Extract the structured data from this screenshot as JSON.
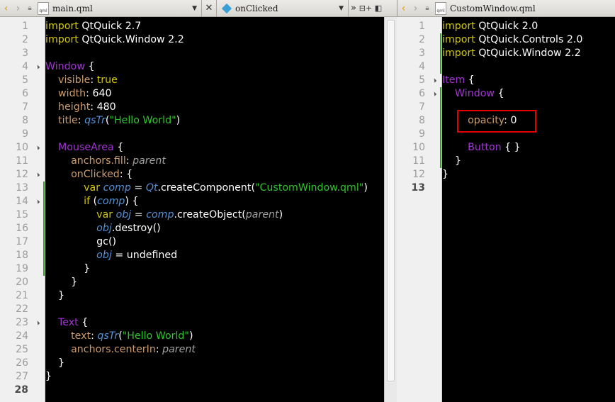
{
  "left_pane": {
    "file_name": "main.qml",
    "file_icon_label": "qml",
    "symbol": "onClicked",
    "extra_buttons": [
      "»",
      "⊟+",
      "◧"
    ],
    "lines": [
      {
        "n": "1",
        "seg": [
          {
            "c": "kw",
            "t": "import"
          },
          {
            "c": "fn",
            "t": " QtQuick 2.7"
          }
        ]
      },
      {
        "n": "2",
        "seg": [
          {
            "c": "kw",
            "t": "import"
          },
          {
            "c": "fn",
            "t": " QtQuick.Window 2.2"
          }
        ]
      },
      {
        "n": "3",
        "seg": []
      },
      {
        "n": "4",
        "fold": true,
        "seg": [
          {
            "c": "ty",
            "t": "Window"
          },
          {
            "c": "fn",
            "t": " {"
          }
        ]
      },
      {
        "n": "5",
        "seg": [
          {
            "c": "fn",
            "t": "    "
          },
          {
            "c": "pr",
            "t": "visible"
          },
          {
            "c": "fn",
            "t": ": "
          },
          {
            "c": "kw",
            "t": "true"
          }
        ]
      },
      {
        "n": "6",
        "seg": [
          {
            "c": "fn",
            "t": "    "
          },
          {
            "c": "pr",
            "t": "width"
          },
          {
            "c": "fn",
            "t": ": 640"
          }
        ]
      },
      {
        "n": "7",
        "seg": [
          {
            "c": "fn",
            "t": "    "
          },
          {
            "c": "pr",
            "t": "height"
          },
          {
            "c": "fn",
            "t": ": 480"
          }
        ]
      },
      {
        "n": "8",
        "seg": [
          {
            "c": "fn",
            "t": "    "
          },
          {
            "c": "pr",
            "t": "title"
          },
          {
            "c": "fn",
            "t": ": "
          },
          {
            "c": "it",
            "t": "qsTr"
          },
          {
            "c": "fn",
            "t": "("
          },
          {
            "c": "st",
            "t": "\"Hello World\""
          },
          {
            "c": "fn",
            "t": ")"
          }
        ]
      },
      {
        "n": "9",
        "seg": []
      },
      {
        "n": "10",
        "fold": true,
        "seg": [
          {
            "c": "fn",
            "t": "    "
          },
          {
            "c": "ty",
            "t": "MouseArea"
          },
          {
            "c": "fn",
            "t": " {"
          }
        ]
      },
      {
        "n": "11",
        "seg": [
          {
            "c": "fn",
            "t": "        "
          },
          {
            "c": "pr",
            "t": "anchors.fill"
          },
          {
            "c": "fn",
            "t": ": "
          },
          {
            "c": "ip",
            "t": "parent"
          }
        ]
      },
      {
        "n": "12",
        "fold": true,
        "seg": [
          {
            "c": "fn",
            "t": "        "
          },
          {
            "c": "pr",
            "t": "onClicked"
          },
          {
            "c": "fn",
            "t": ": {"
          }
        ]
      },
      {
        "n": "13",
        "mod": true,
        "seg": [
          {
            "c": "fn",
            "t": "            "
          },
          {
            "c": "kw",
            "t": "var"
          },
          {
            "c": "fn",
            "t": " "
          },
          {
            "c": "it",
            "t": "comp"
          },
          {
            "c": "fn",
            "t": " = "
          },
          {
            "c": "it",
            "t": "Qt"
          },
          {
            "c": "fn",
            "t": ".createComponent("
          },
          {
            "c": "st",
            "t": "\"CustomWindow.qml\""
          },
          {
            "c": "fn",
            "t": ")"
          }
        ]
      },
      {
        "n": "14",
        "mod": true,
        "fold": true,
        "seg": [
          {
            "c": "fn",
            "t": "            "
          },
          {
            "c": "kw",
            "t": "if"
          },
          {
            "c": "fn",
            "t": " ("
          },
          {
            "c": "it",
            "t": "comp"
          },
          {
            "c": "fn",
            "t": ") {"
          }
        ]
      },
      {
        "n": "15",
        "mod": true,
        "seg": [
          {
            "c": "fn",
            "t": "                "
          },
          {
            "c": "kw",
            "t": "var"
          },
          {
            "c": "fn",
            "t": " "
          },
          {
            "c": "it",
            "t": "obj"
          },
          {
            "c": "fn",
            "t": " = "
          },
          {
            "c": "it",
            "t": "comp"
          },
          {
            "c": "fn",
            "t": ".createObject("
          },
          {
            "c": "ip",
            "t": "parent"
          },
          {
            "c": "fn",
            "t": ")"
          }
        ]
      },
      {
        "n": "16",
        "mod": true,
        "seg": [
          {
            "c": "fn",
            "t": "                "
          },
          {
            "c": "it",
            "t": "obj"
          },
          {
            "c": "fn",
            "t": ".destroy()"
          }
        ]
      },
      {
        "n": "17",
        "mod": true,
        "seg": [
          {
            "c": "fn",
            "t": "                gc()"
          }
        ]
      },
      {
        "n": "18",
        "mod": true,
        "seg": [
          {
            "c": "fn",
            "t": "                "
          },
          {
            "c": "it",
            "t": "obj"
          },
          {
            "c": "fn",
            "t": " = undefined"
          }
        ]
      },
      {
        "n": "19",
        "mod": true,
        "seg": [
          {
            "c": "fn",
            "t": "            }"
          }
        ]
      },
      {
        "n": "20",
        "seg": [
          {
            "c": "fn",
            "t": "        }"
          }
        ]
      },
      {
        "n": "21",
        "seg": [
          {
            "c": "fn",
            "t": "    }"
          }
        ]
      },
      {
        "n": "22",
        "seg": []
      },
      {
        "n": "23",
        "fold": true,
        "seg": [
          {
            "c": "fn",
            "t": "    "
          },
          {
            "c": "ty",
            "t": "Text"
          },
          {
            "c": "fn",
            "t": " {"
          }
        ]
      },
      {
        "n": "24",
        "seg": [
          {
            "c": "fn",
            "t": "        "
          },
          {
            "c": "pr",
            "t": "text"
          },
          {
            "c": "fn",
            "t": ": "
          },
          {
            "c": "it",
            "t": "qsTr"
          },
          {
            "c": "fn",
            "t": "("
          },
          {
            "c": "st",
            "t": "\"Hello World\""
          },
          {
            "c": "fn",
            "t": ")"
          }
        ]
      },
      {
        "n": "25",
        "seg": [
          {
            "c": "fn",
            "t": "        "
          },
          {
            "c": "pr",
            "t": "anchors.centerIn"
          },
          {
            "c": "fn",
            "t": ": "
          },
          {
            "c": "ip",
            "t": "parent"
          }
        ]
      },
      {
        "n": "26",
        "seg": [
          {
            "c": "fn",
            "t": "    }"
          }
        ]
      },
      {
        "n": "27",
        "seg": [
          {
            "c": "fn",
            "t": "}"
          }
        ]
      },
      {
        "n": "28",
        "current": true,
        "seg": []
      }
    ]
  },
  "right_pane": {
    "file_name": "CustomWindow.qml",
    "file_icon_label": "qml",
    "lines": [
      {
        "n": "1",
        "seg": [
          {
            "c": "kw",
            "t": "import"
          },
          {
            "c": "fn",
            "t": " QtQuick 2.0"
          }
        ]
      },
      {
        "n": "2",
        "mod": true,
        "seg": [
          {
            "c": "kw",
            "t": "import"
          },
          {
            "c": "fn",
            "t": " QtQuick.Controls 2.0"
          }
        ]
      },
      {
        "n": "3",
        "mod": true,
        "seg": [
          {
            "c": "kw",
            "t": "import"
          },
          {
            "c": "fn",
            "t": " QtQuick.Window 2.2"
          }
        ]
      },
      {
        "n": "4",
        "mod": true,
        "seg": []
      },
      {
        "n": "5",
        "fold": true,
        "seg": [
          {
            "c": "ty",
            "t": "Item"
          },
          {
            "c": "fn",
            "t": " {"
          }
        ]
      },
      {
        "n": "6",
        "mod": true,
        "fold": true,
        "seg": [
          {
            "c": "fn",
            "t": "    "
          },
          {
            "c": "ty",
            "t": "Window"
          },
          {
            "c": "fn",
            "t": " {"
          }
        ]
      },
      {
        "n": "7",
        "mod": true,
        "seg": []
      },
      {
        "n": "8",
        "mod": true,
        "seg": [
          {
            "c": "fn",
            "t": "        "
          },
          {
            "c": "pr",
            "t": "opacity"
          },
          {
            "c": "fn",
            "t": ": 0"
          }
        ]
      },
      {
        "n": "9",
        "mod": true,
        "seg": []
      },
      {
        "n": "10",
        "mod": true,
        "seg": [
          {
            "c": "fn",
            "t": "        "
          },
          {
            "c": "ty",
            "t": "Button"
          },
          {
            "c": "fn",
            "t": " { }"
          }
        ]
      },
      {
        "n": "11",
        "mod": true,
        "seg": [
          {
            "c": "fn",
            "t": "    }"
          }
        ]
      },
      {
        "n": "12",
        "seg": [
          {
            "c": "fn",
            "t": "}"
          }
        ]
      },
      {
        "n": "13",
        "current": true,
        "seg": []
      }
    ]
  },
  "colors": {
    "keyword": "#d4c800",
    "type": "#a333d6",
    "property": "#cc9d6c",
    "string": "#2cc52c",
    "identifier": "#5591d6",
    "highlight_box": "#e00000"
  }
}
